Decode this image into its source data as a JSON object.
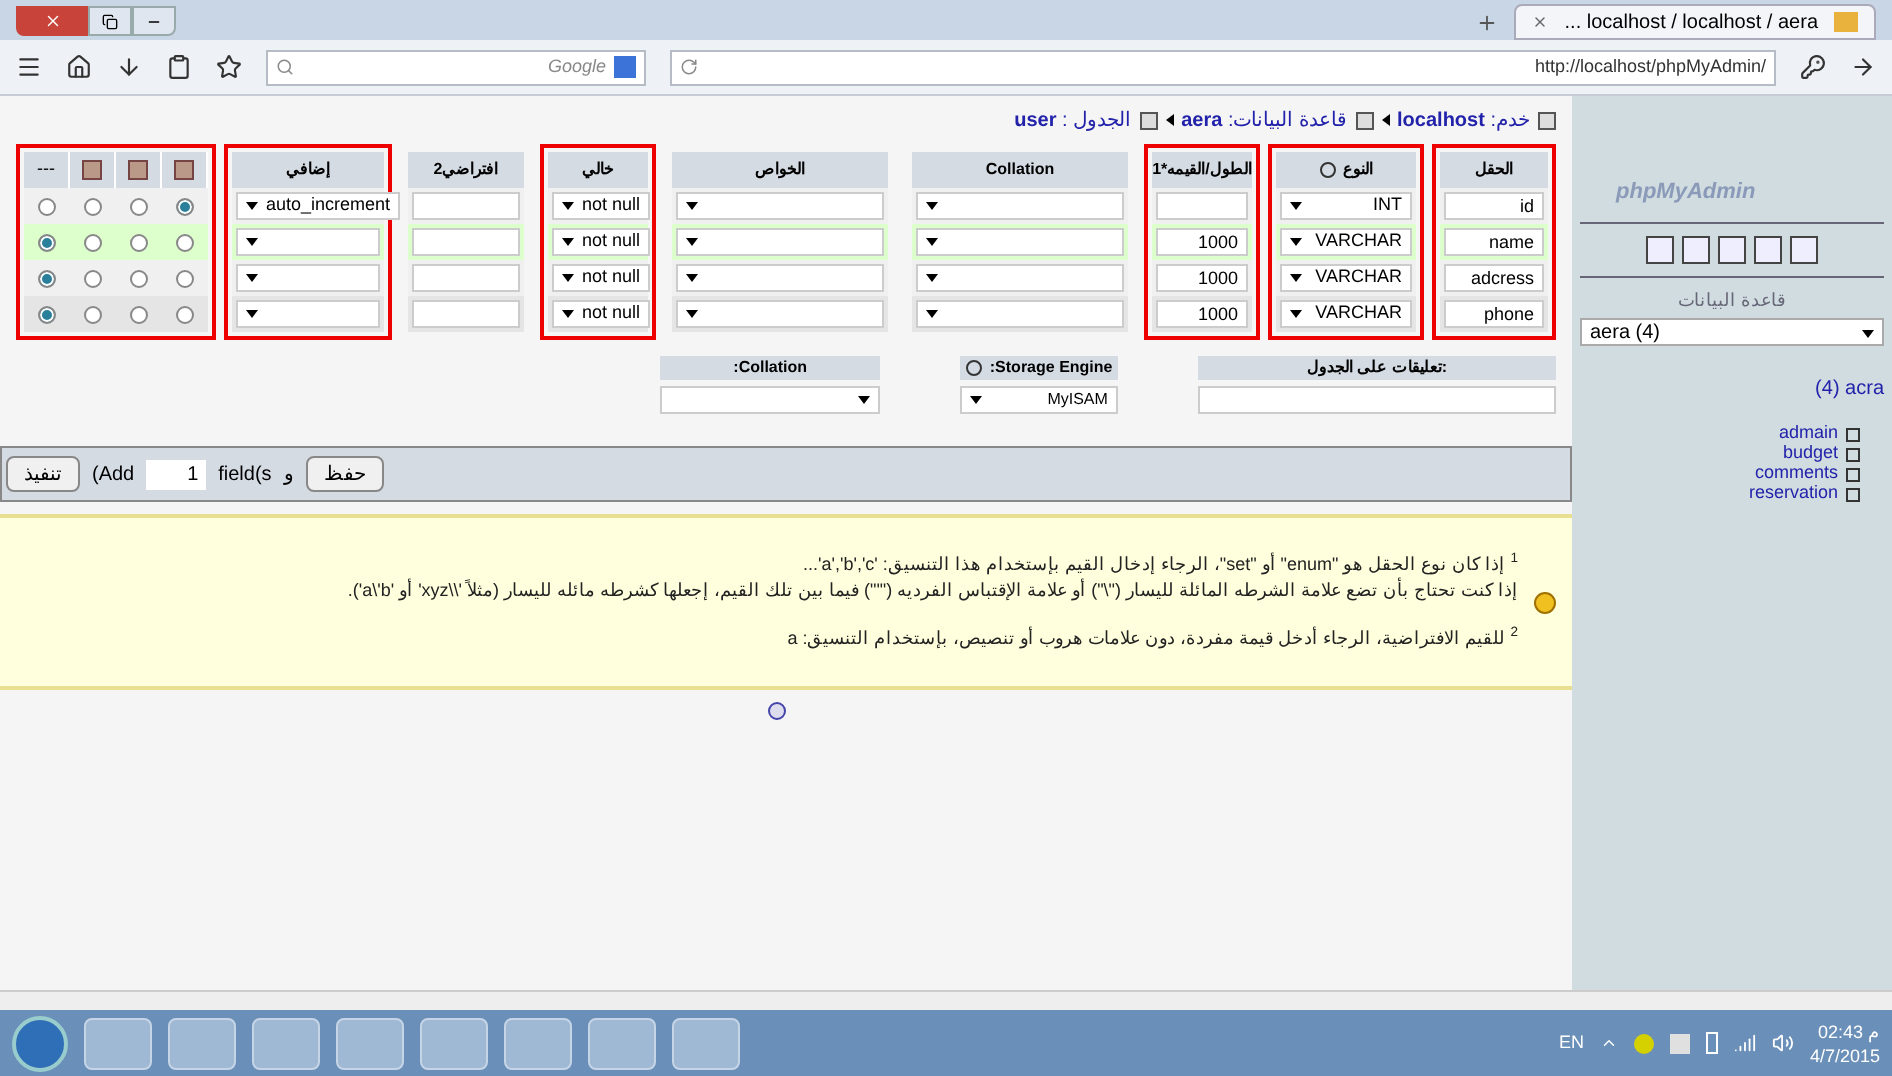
{
  "browser": {
    "tab_title": "... localhost / localhost / aera",
    "search_placeholder": "Google",
    "address": "http://localhost/phpMyAdmin/"
  },
  "breadcrumb": [
    {
      "label": "خدم:",
      "value": "localhost"
    },
    {
      "label": "قاعدة البيانات:",
      "value": "aera"
    },
    {
      "label": "الجدول :",
      "value": "user"
    }
  ],
  "columns": [
    {
      "label": "الحقل",
      "highlighted": true,
      "kind": "input"
    },
    {
      "label": "النوع",
      "highlighted": true,
      "kind": "select",
      "help": true
    },
    {
      "label": "الطول/القيمه*1",
      "highlighted": true,
      "kind": "input"
    },
    {
      "label": "Collation",
      "highlighted": false,
      "kind": "select"
    },
    {
      "label": "الخواص",
      "highlighted": false,
      "kind": "select"
    },
    {
      "label": "خالي",
      "highlighted": true,
      "kind": "select"
    },
    {
      "label": "افتراضي2",
      "highlighted": false,
      "kind": "input"
    },
    {
      "label": "إضافي",
      "highlighted": true,
      "kind": "select"
    }
  ],
  "radio_group_highlighted": true,
  "radio_headers": [
    {
      "kind": "icon"
    },
    {
      "kind": "icon"
    },
    {
      "kind": "icon"
    },
    {
      "kind": "text",
      "label": "---"
    }
  ],
  "rows": [
    {
      "hover": false,
      "field": "id",
      "type": "INT",
      "extra": "auto_increment",
      "null": "not null",
      "index": [
        {
          "selected": true
        },
        {
          "selected": false
        },
        {
          "selected": false
        },
        {
          "selected": false
        }
      ]
    },
    {
      "hover": true,
      "field": "name",
      "type": "VARCHAR",
      "length": "1000",
      "null": "not null",
      "index": [
        {
          "selected": false
        },
        {
          "selected": false
        },
        {
          "selected": false
        },
        {
          "selected": true
        }
      ]
    },
    {
      "hover": false,
      "field": "adcress",
      "type": "VARCHAR",
      "length": "1000",
      "null": "not null",
      "index": [
        {
          "selected": false
        },
        {
          "selected": false
        },
        {
          "selected": false
        },
        {
          "selected": true
        }
      ]
    },
    {
      "hover": false,
      "field": "phone",
      "type": "VARCHAR",
      "length": "1000",
      "null": "not null",
      "index": [
        {
          "selected": false
        },
        {
          "selected": false
        },
        {
          "selected": false
        },
        {
          "selected": true
        }
      ]
    }
  ],
  "table_options": {
    "collation_label": ":Collation",
    "engine_label": ":Storage Engine",
    "engine": "MyISAM",
    "comments_label": "تعليقات على الجدول:"
  },
  "add_bar": {
    "go_button": "تنفيذ",
    "add_text": "(Add",
    "count": "1",
    "fields_text": "field(s",
    "or_text": "و",
    "save_button": "حفظ"
  },
  "notes": [
    {
      "mark": "1",
      "lines": [
        "إذا كان نوع الحقل هو \"enum\" أو \"set\"، الرجاء إدخال القيم بإستخدام هذا التنسيق: 'a','b','c'...",
        "إذا كنت تحتاج بأن تضع علامة الشرطه المائلة لليسار (\"\\\") أو علامة الإقتباس الفرديه (\"'\") فيما بين تلك القيم، إجعلها كشرطه مائله لليسار (مثلاً '\\\\xyz' أو 'a\\'b')."
      ]
    },
    {
      "mark": "2",
      "lines": [
        "للقيم الافتراضية، الرجاء أدخل قيمة مفردة، دون علامات هروب أو تنصيص، بإستخدام التنسيق: a"
      ]
    }
  ],
  "sidebar": {
    "logo": "phpMyAdmin",
    "db_label": "قاعدة البيانات",
    "db_select": "aera (4)",
    "db_link": "(4) acra",
    "tables": [
      {
        "name": "admain"
      },
      {
        "name": "budget"
      },
      {
        "name": "comments"
      },
      {
        "name": "reservation"
      }
    ]
  },
  "taskbar": {
    "language": "EN",
    "time": "02:43 م",
    "date": "4/7/2015"
  }
}
